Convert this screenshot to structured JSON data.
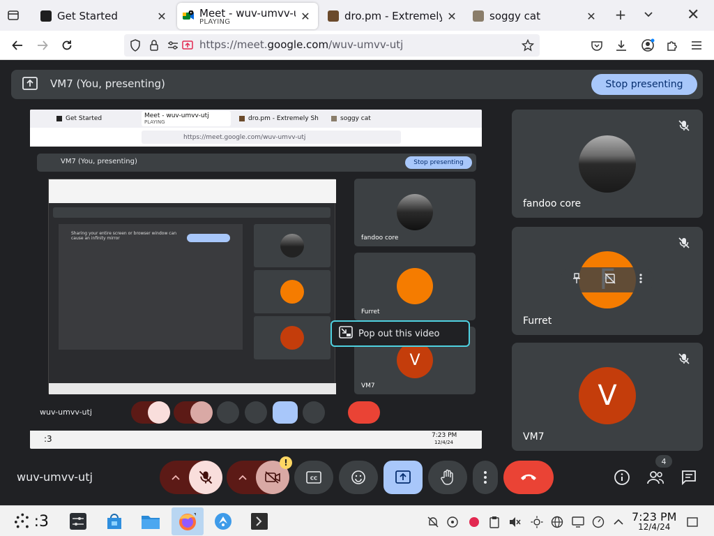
{
  "browser": {
    "tabs": [
      {
        "title": "Get Started",
        "active": false
      },
      {
        "title": "Meet - wuv-umvv-utj",
        "subtitle": "PLAYING",
        "active": true
      },
      {
        "title": "dro.pm - Extremely Sh",
        "active": false
      },
      {
        "title": "soggy cat",
        "active": false
      }
    ],
    "url": {
      "prefix": "https://meet.",
      "domain": "google.com",
      "path": "/wuv-umvv-utj"
    }
  },
  "meet": {
    "presenting_label": "VM7 (You, presenting)",
    "stop_presenting_label": "Stop presenting",
    "participants": [
      {
        "name": "fandoo core",
        "avatar": "gradient-sphere",
        "muted": true
      },
      {
        "name": "Furret",
        "avatar_letter": "F",
        "avatar_color": "#f57c00",
        "muted": true
      },
      {
        "name": "VM7",
        "avatar_letter": "V",
        "avatar_color": "#c43d0b",
        "muted": true
      }
    ],
    "meeting_code": "wuv-umvv-utj",
    "people_count": "4",
    "popout_label": "Pop out this video",
    "camera_warning": "!"
  },
  "nested": {
    "tabs": [
      "Get Started",
      "Meet - wuv-umvv-utj",
      "dro.pm - Extremely Sh",
      "soggy cat"
    ],
    "playing": "PLAYING",
    "url": "https://meet.google.com/wuv-umvv-utj",
    "presenting_label": "VM7 (You, presenting)",
    "stop_label": "Stop presenting",
    "participants": [
      "fandoo core",
      "Furret",
      "VM7"
    ],
    "meeting_code": "wuv-umvv-utj",
    "clock_time": "7:23 PM",
    "clock_date": "12/4/24",
    "deep_text": "Sharing your entire screen or browser window can cause an infinity mirror"
  },
  "taskbar": {
    "launcher_label": ":3",
    "clock_time": "7:23 PM",
    "clock_date": "12/4/24"
  },
  "colors": {
    "meet_bg": "#202124",
    "tile_bg": "#3c4043",
    "stop_btn": "#a8c7fa",
    "end_call": "#ea4335",
    "muted_bg": "#f9dedc",
    "present_active": "#a8c7fa"
  }
}
